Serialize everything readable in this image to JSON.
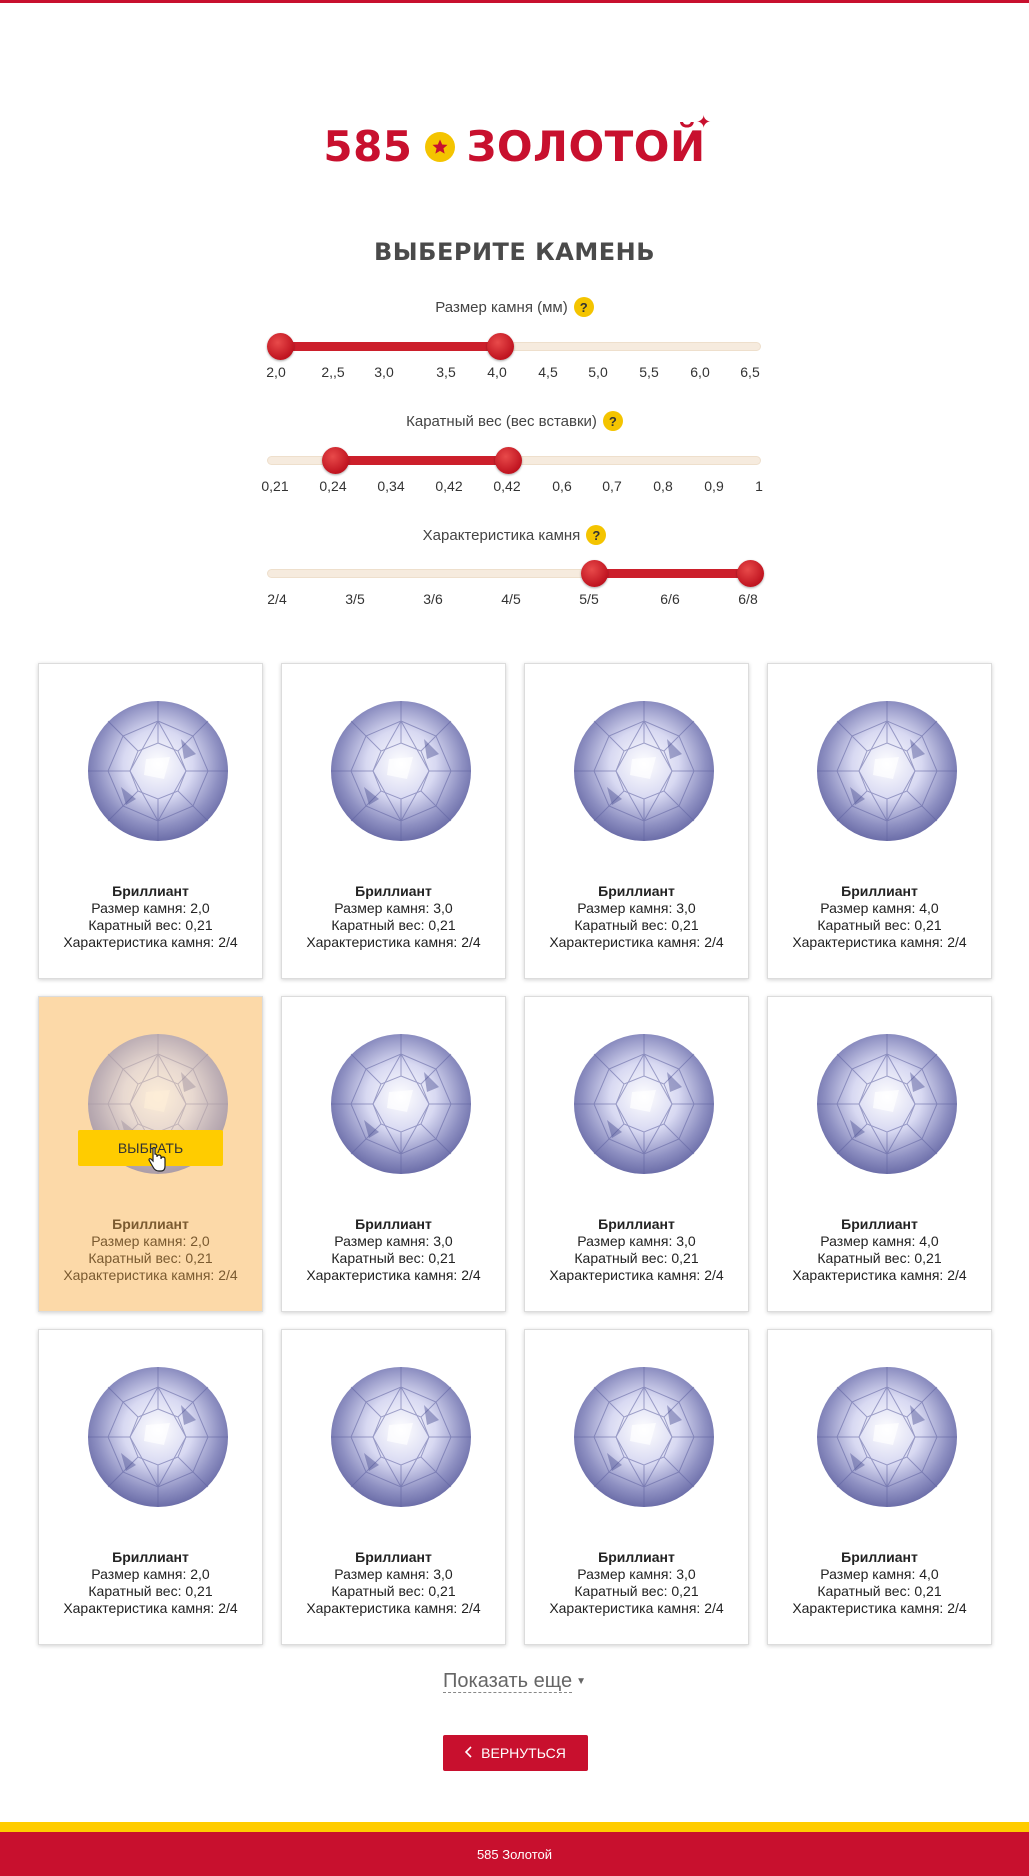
{
  "brand": {
    "number": "585",
    "word": "ЗОЛОТОЙ"
  },
  "title": "ВЫБЕРИТЕ КАМЕНЬ",
  "filters": [
    {
      "label": "Размер камня (мм)",
      "help": "?",
      "ticks": [
        "2,0",
        "2,,5",
        "3,0",
        "3,5",
        "4,0",
        "4,5",
        "5,0",
        "5,5",
        "6,0",
        "6,5"
      ],
      "selected_min": "2,0",
      "selected_max": "4,0"
    },
    {
      "label": "Каратный вес (вес вставки)",
      "help": "?",
      "ticks": [
        "0,21",
        "0,24",
        "0,34",
        "0,42",
        "0,42",
        "0,6",
        "0,7",
        "0,8",
        "0,9",
        "1"
      ],
      "selected_min": "0,24",
      "selected_max": "0,42"
    },
    {
      "label": "Характеристика камня",
      "help": "?",
      "ticks": [
        "2/4",
        "3/5",
        "3/6",
        "4/5",
        "5/5",
        "6/6",
        "6/8"
      ],
      "selected_min": "5/5",
      "selected_max": "6/8"
    }
  ],
  "cards": [
    {
      "name": "Бриллиант",
      "size": "Размер камня: 2,0",
      "weight": "Каратный вес: 0,21",
      "char": "Характеристика камня: 2/4"
    },
    {
      "name": "Бриллиант",
      "size": "Размер камня: 3,0",
      "weight": "Каратный вес: 0,21",
      "char": "Характеристика камня: 2/4"
    },
    {
      "name": "Бриллиант",
      "size": "Размер камня: 3,0",
      "weight": "Каратный вес: 0,21",
      "char": "Характеристика камня: 2/4"
    },
    {
      "name": "Бриллиант",
      "size": "Размер камня: 4,0",
      "weight": "Каратный вес: 0,21",
      "char": "Характеристика камня: 2/4"
    },
    {
      "name": "Бриллиант",
      "size": "Размер камня: 2,0",
      "weight": "Каратный вес: 0,21",
      "char": "Характеристика камня: 2/4"
    },
    {
      "name": "Бриллиант",
      "size": "Размер камня: 3,0",
      "weight": "Каратный вес: 0,21",
      "char": "Характеристика камня: 2/4"
    },
    {
      "name": "Бриллиант",
      "size": "Размер камня: 3,0",
      "weight": "Каратный вес: 0,21",
      "char": "Характеристика камня: 2/4"
    },
    {
      "name": "Бриллиант",
      "size": "Размер камня: 4,0",
      "weight": "Каратный вес: 0,21",
      "char": "Характеристика камня: 2/4"
    },
    {
      "name": "Бриллиант",
      "size": "Размер камня: 2,0",
      "weight": "Каратный вес: 0,21",
      "char": "Характеристика камня: 2/4"
    },
    {
      "name": "Бриллиант",
      "size": "Размер камня: 3,0",
      "weight": "Каратный вес: 0,21",
      "char": "Характеристика камня: 2/4"
    },
    {
      "name": "Бриллиант",
      "size": "Размер камня: 3,0",
      "weight": "Каратный вес: 0,21",
      "char": "Характеристика камня: 2/4"
    },
    {
      "name": "Бриллиант",
      "size": "Размер камня: 4,0",
      "weight": "Каратный вес: 0,21",
      "char": "Характеристика камня: 2/4"
    }
  ],
  "choose_label": "ВЫБРАТЬ",
  "show_more": "Показать еще",
  "back_label": "ВЕРНУТЬСЯ",
  "footer": "585 Золотой",
  "colors": {
    "brand_red": "#c8102e",
    "accent_yellow": "#ffcc00",
    "hover_card": "#fcd9a8"
  }
}
